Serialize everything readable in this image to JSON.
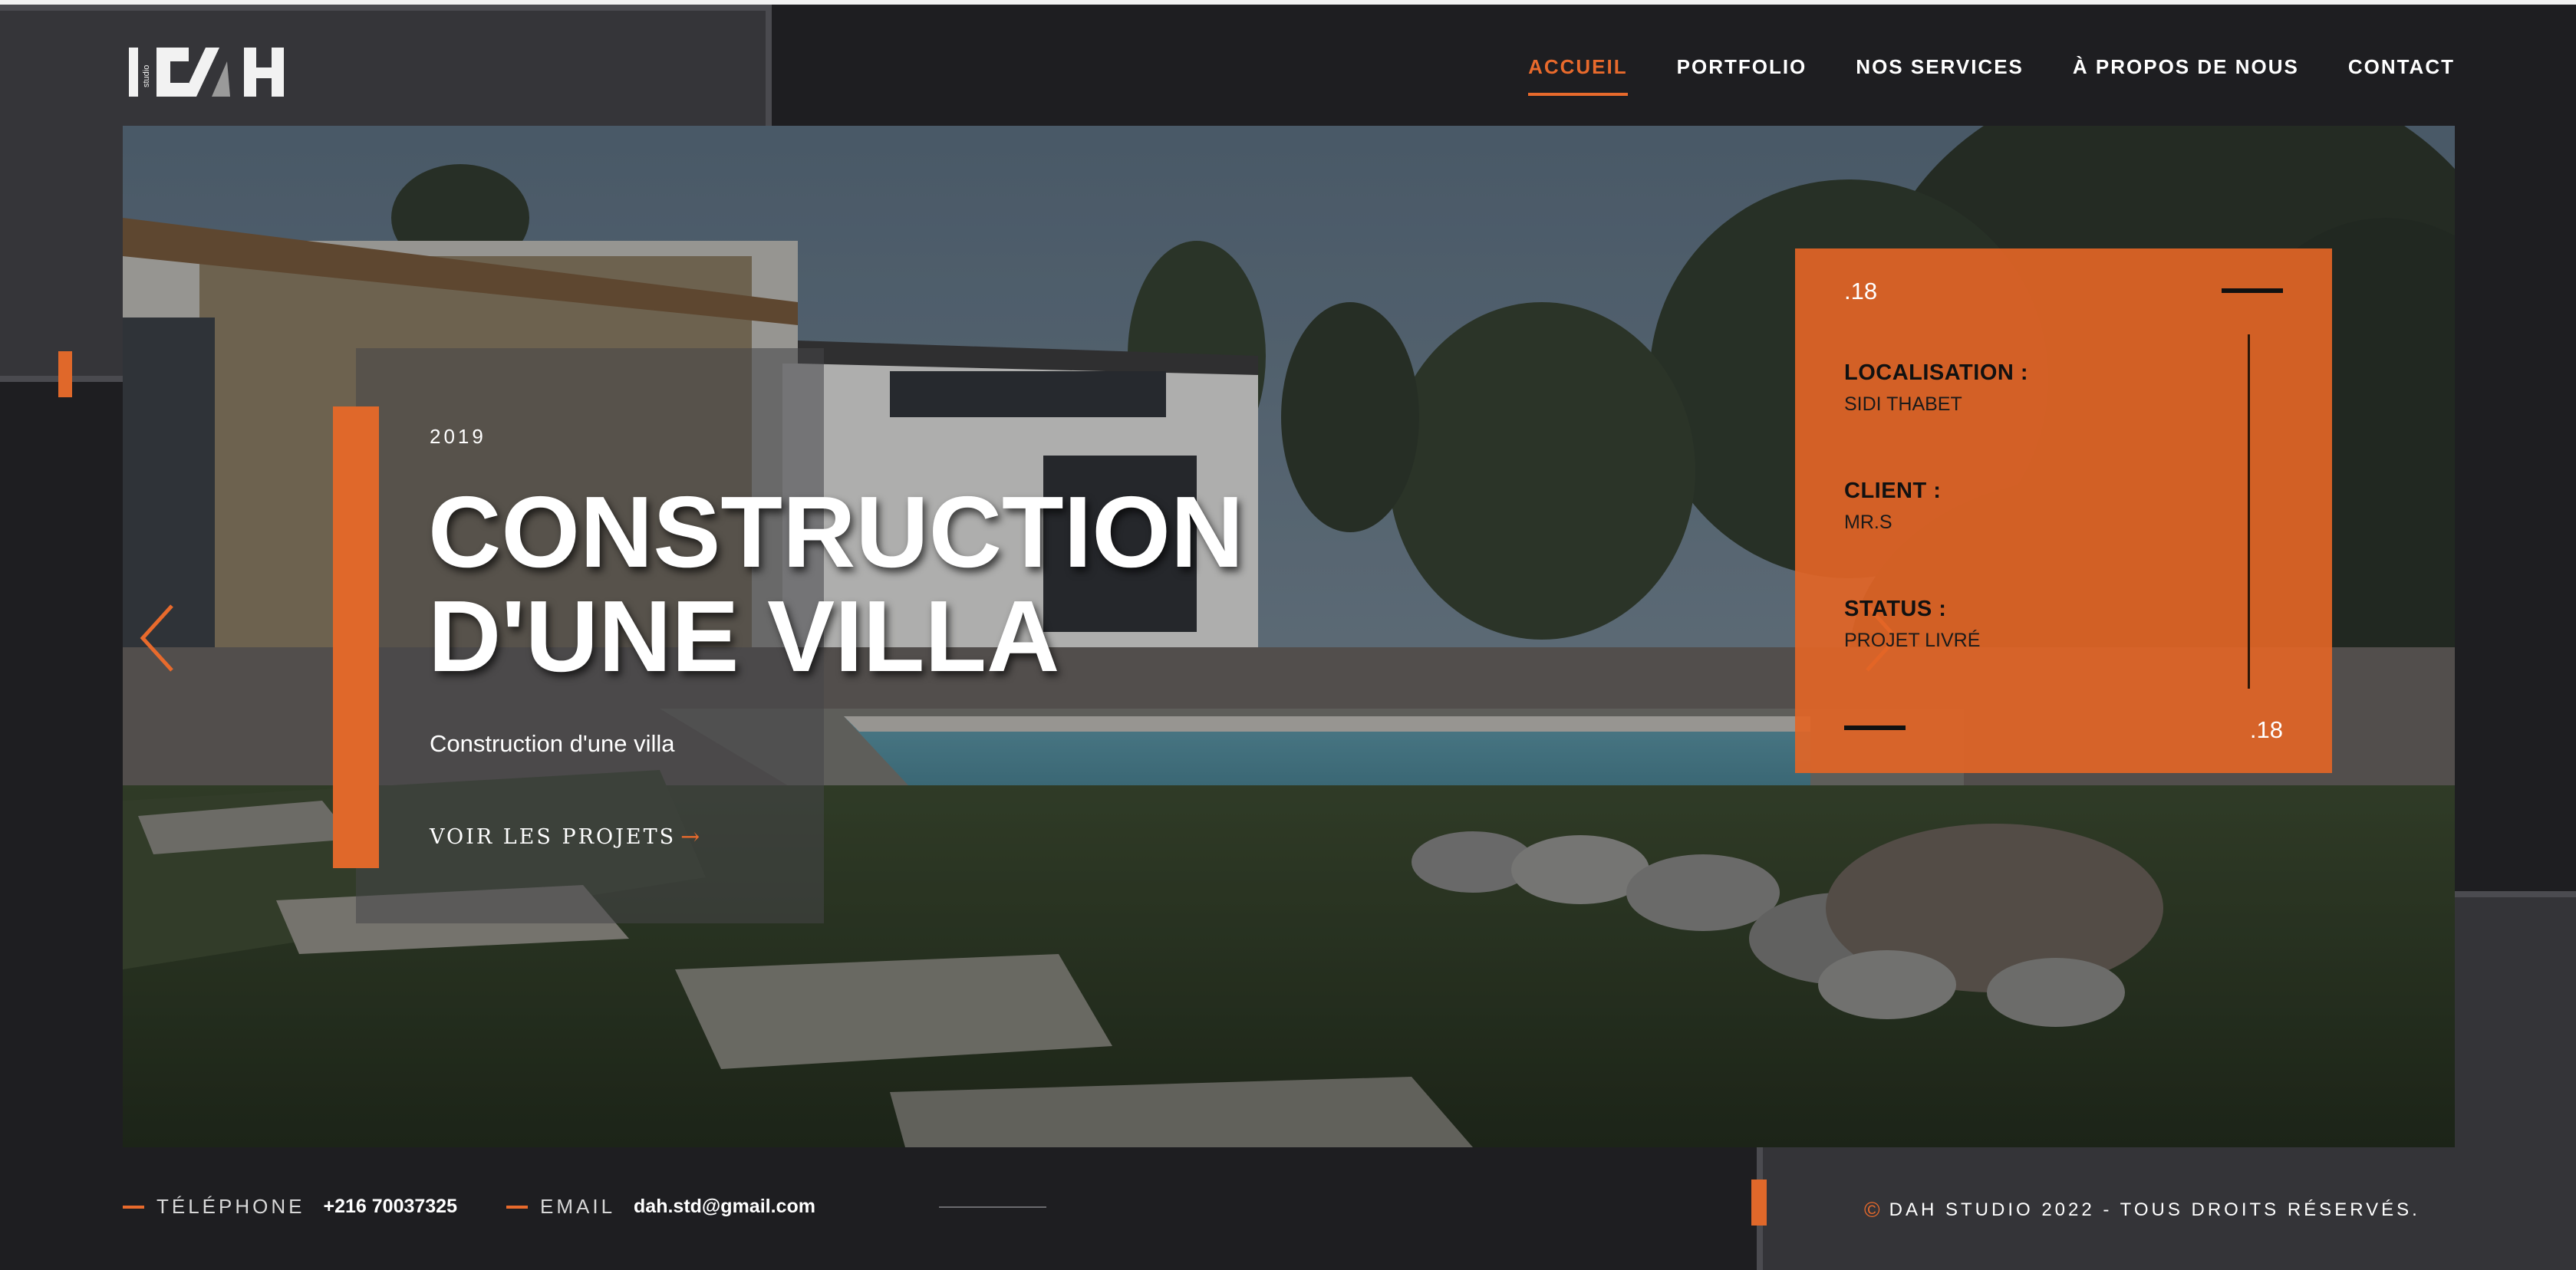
{
  "header": {
    "logo_text": "DAH",
    "logo_small": "studio",
    "nav": [
      {
        "label": "ACCUEIL",
        "active": true
      },
      {
        "label": "PORTFOLIO",
        "active": false
      },
      {
        "label": "NOS SERVICES",
        "active": false
      },
      {
        "label": "À PROPOS DE NOUS",
        "active": false
      },
      {
        "label": "CONTACT",
        "active": false
      }
    ]
  },
  "hero": {
    "year": "2019",
    "title_line1": "CONSTRUCTION",
    "title_line2": "D'UNE VILLA",
    "subtitle": "Construction d'une villa",
    "cta_label": "VOIR LES PROJETS",
    "cta_arrow": "→"
  },
  "card": {
    "index_top": ".18",
    "index_bottom": ".18",
    "fields": [
      {
        "label": "LOCALISATION :",
        "value": "SIDI THABET"
      },
      {
        "label": "CLIENT :",
        "value": "MR.S"
      },
      {
        "label": "STATUS :",
        "value": "PROJET LIVRÉ"
      }
    ]
  },
  "footer": {
    "phone_label": "TÉLÉPHONE",
    "phone_value": "+216 70037325",
    "email_label": "EMAIL",
    "email_value": "dah.std@gmail.com",
    "copyright_symbol": "©",
    "copyright_text": "DAH STUDIO 2022 - TOUS DROITS RÉSERVÉS."
  },
  "colors": {
    "accent": "#e86a2c",
    "background": "#1e1e21",
    "card": "#e26526"
  }
}
